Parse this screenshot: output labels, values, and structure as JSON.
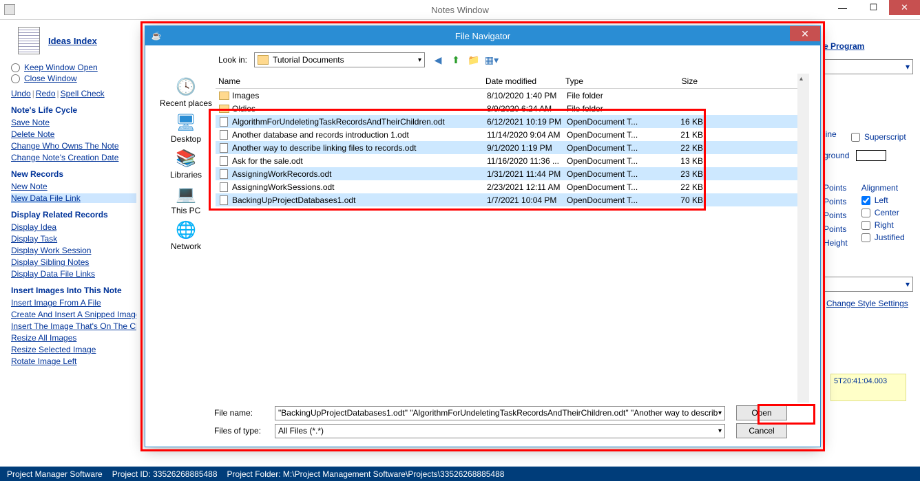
{
  "window": {
    "title": "Notes Window"
  },
  "sidebar": {
    "ideas_index": "Ideas Index",
    "keep_window": "Keep Window Open",
    "close_window": "Close Window",
    "undo": "Undo",
    "redo": "Redo",
    "spellcheck": "Spell Check",
    "sections": {
      "life_cycle": {
        "header": "Note's Life Cycle",
        "items": [
          "Save Note",
          "Delete Note",
          "Change Who Owns The Note",
          "Change Note's Creation Date"
        ]
      },
      "new_records": {
        "header": "New Records",
        "items": [
          "New Note",
          "New Data File Link"
        ]
      },
      "display": {
        "header": "Display Related Records",
        "items": [
          "Display Idea",
          "Display Task",
          "Display Work Session",
          "Display Sibling Notes",
          "Display Data File Links"
        ]
      },
      "insert": {
        "header": "Insert Images Into This Note",
        "items": [
          "Insert Image From A File",
          "Create And Insert A Snipped Image",
          "Insert The Image That's On The Clipboard Right Now",
          "Resize All Images",
          "Resize Selected Image",
          "Rotate Image Left"
        ]
      }
    }
  },
  "right_panel": {
    "program_label": "e Program",
    "line_label": "line",
    "superscript": "Superscript",
    "ground_label": "ground",
    "points": "Points",
    "alignment_header": "Alignment",
    "alignment": [
      "Left",
      "Center",
      "Right",
      "Justified"
    ],
    "height_label": "Height",
    "change_style": "Change Style Settings",
    "timestamp_fragment": "5T20:41:04.003"
  },
  "dialog": {
    "title": "File Navigator",
    "look_in_label": "Look in:",
    "look_in_value": "Tutorial Documents",
    "places": [
      "Recent places",
      "Desktop",
      "Libraries",
      "This PC",
      "Network"
    ],
    "columns": {
      "name": "Name",
      "date": "Date modified",
      "type": "Type",
      "size": "Size"
    },
    "rows": [
      {
        "name": "Images",
        "date": "8/10/2020 1:40 PM",
        "type": "File folder",
        "size": "",
        "folder": true,
        "sel": false
      },
      {
        "name": "Oldies",
        "date": "8/9/2020 6:24 AM",
        "type": "File folder",
        "size": "",
        "folder": true,
        "sel": false
      },
      {
        "name": "AlgorithmForUndeletingTaskRecordsAndTheirChildren.odt",
        "date": "6/12/2021 10:19 PM",
        "type": "OpenDocument T...",
        "size": "16 KB",
        "folder": false,
        "sel": true
      },
      {
        "name": "Another database and records introduction 1.odt",
        "date": "11/14/2020 9:04 AM",
        "type": "OpenDocument T...",
        "size": "21 KB",
        "folder": false,
        "sel": false
      },
      {
        "name": "Another way to describe linking files to records.odt",
        "date": "9/1/2020 1:19 PM",
        "type": "OpenDocument T...",
        "size": "22 KB",
        "folder": false,
        "sel": true
      },
      {
        "name": "Ask for the sale.odt",
        "date": "11/16/2020 11:36 ...",
        "type": "OpenDocument T...",
        "size": "13 KB",
        "folder": false,
        "sel": false
      },
      {
        "name": "AssigningWorkRecords.odt",
        "date": "1/31/2021 11:44 PM",
        "type": "OpenDocument T...",
        "size": "23 KB",
        "folder": false,
        "sel": true
      },
      {
        "name": "AssigningWorkSessions.odt",
        "date": "2/23/2021 12:11 AM",
        "type": "OpenDocument T...",
        "size": "22 KB",
        "folder": false,
        "sel": false
      },
      {
        "name": "BackingUpProjectDatabases1.odt",
        "date": "1/7/2021 10:04 PM",
        "type": "OpenDocument T...",
        "size": "70 KB",
        "folder": false,
        "sel": true
      }
    ],
    "file_name_label": "File name:",
    "file_name_value": "\"BackingUpProjectDatabases1.odt\" \"AlgorithmForUndeletingTaskRecordsAndTheirChildren.odt\" \"Another way to describe linking files to",
    "files_type_label": "Files of type:",
    "files_type_value": "All Files (*.*)",
    "open": "Open",
    "cancel": "Cancel"
  },
  "statusbar": {
    "app": "Project Manager Software",
    "project_id_label": "Project ID:",
    "project_id": "33526268885488",
    "folder_label": "Project Folder:",
    "folder": "M:\\Project Management Software\\Projects\\33526268885488"
  }
}
